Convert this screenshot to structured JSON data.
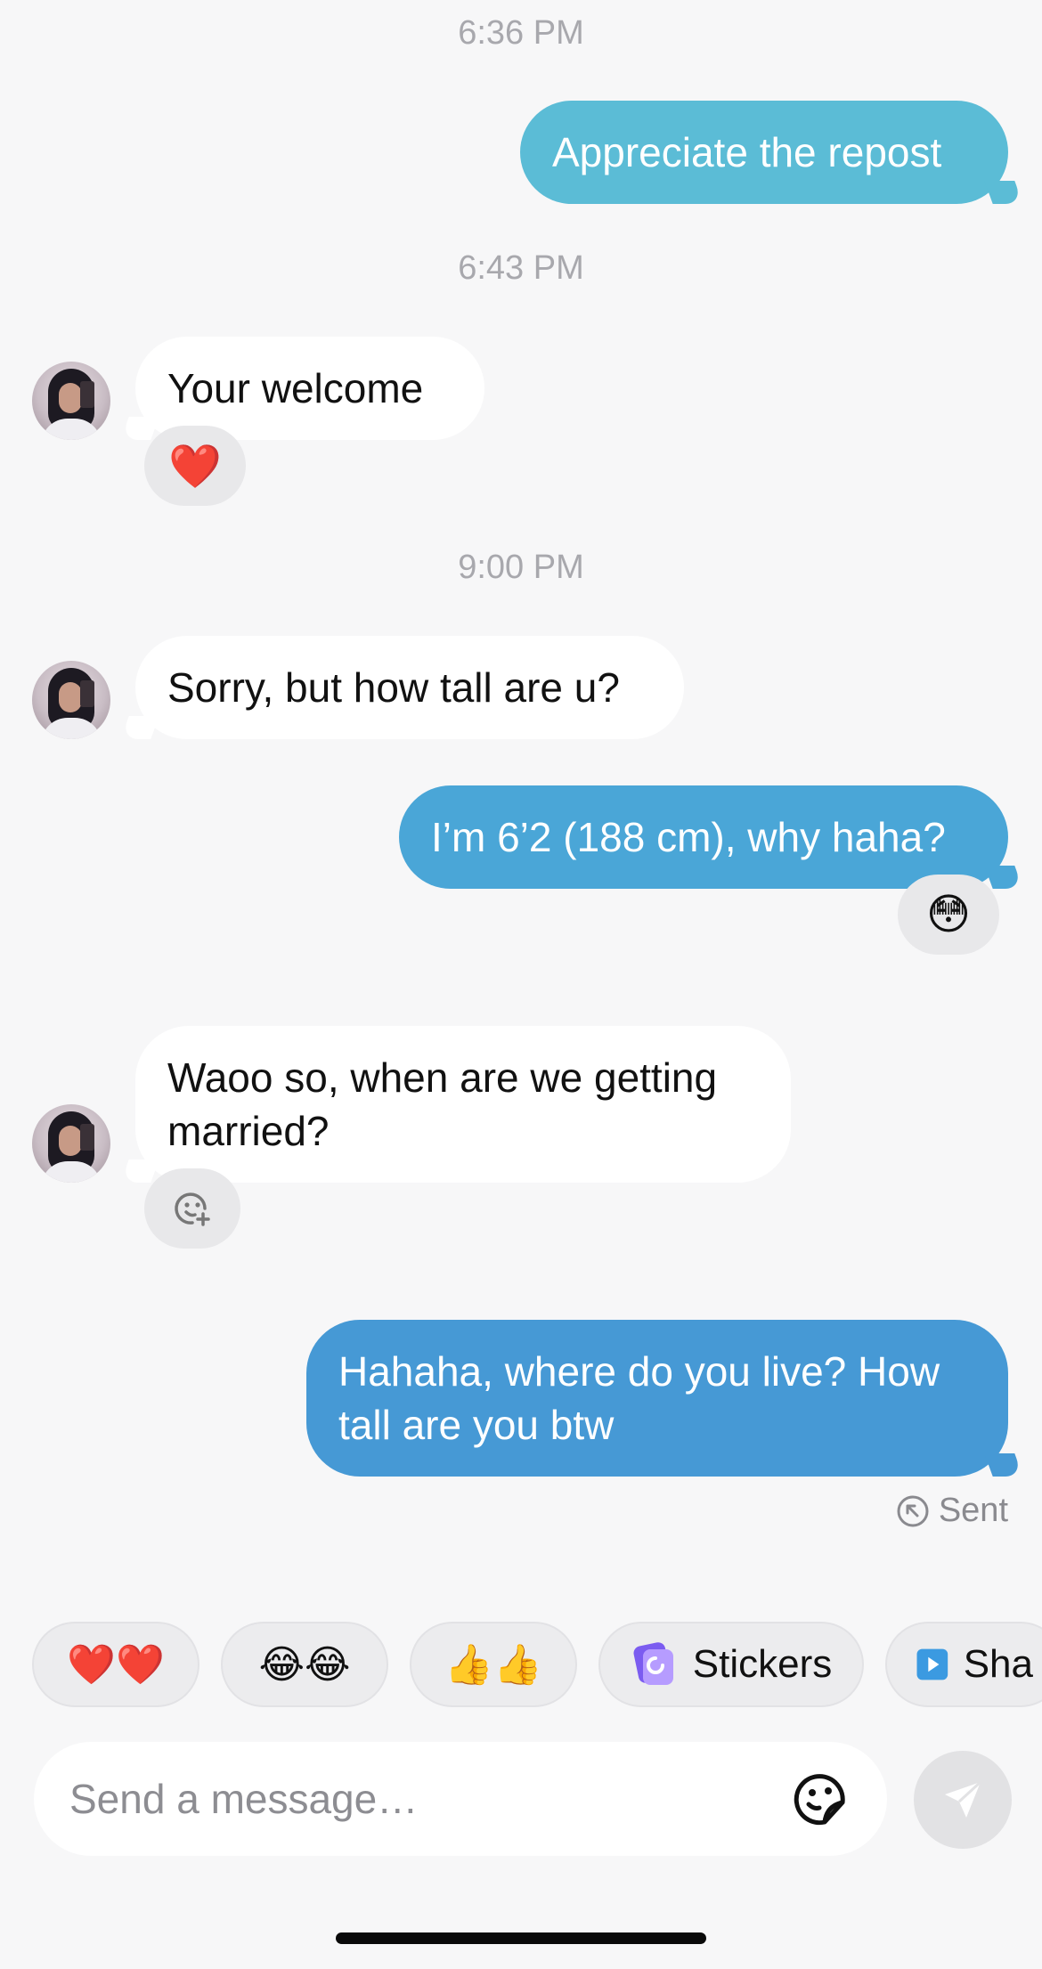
{
  "timestamps": [
    "6:36 PM",
    "6:43 PM",
    "9:00 PM"
  ],
  "messages": {
    "m1": "Appreciate the repost",
    "m2": "Your  welcome",
    "m3": "Sorry, but how tall are u?",
    "m4": "I’m 6’2 (188 cm), why haha?",
    "m5_line1": "Waoo so, when are we getting",
    "m5_line2": "married?",
    "m6_line1": "Hahaha, where do you live? How",
    "m6_line2": "tall are you btw"
  },
  "reactions": {
    "m2": "❤️",
    "m4": "😳",
    "m5_icon": "add-reaction-icon"
  },
  "status": {
    "label": "Sent",
    "icon": "sent-arrow-icon"
  },
  "quick_replies": [
    {
      "label": "❤️❤️"
    },
    {
      "label": "😂😂"
    },
    {
      "label": "👍👍"
    },
    {
      "label": "Stickers",
      "icon": "stickers-icon"
    },
    {
      "label": "Sha",
      "icon": "share-play-icon"
    }
  ],
  "composer": {
    "placeholder": "Send a message…",
    "sticker_icon": "sticker-icon",
    "send_icon": "send-icon"
  },
  "colors": {
    "background": "#f7f7f8",
    "incoming_bubble": "#ffffff",
    "outgoing_bubble_1": "#5bbcd6",
    "outgoing_bubble_2": "#4aa6d7",
    "outgoing_bubble_3": "#4699d5"
  }
}
